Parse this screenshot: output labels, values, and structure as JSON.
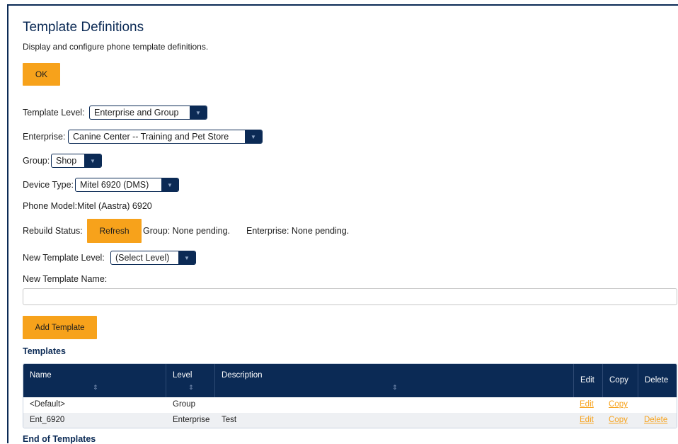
{
  "page": {
    "title": "Template Definitions",
    "subtitle": "Display and configure phone template definitions.",
    "ok_label": "OK"
  },
  "form": {
    "template_level_label": "Template Level:",
    "template_level_value": "Enterprise and Group",
    "enterprise_label": "Enterprise:",
    "enterprise_value": "Canine Center -- Training and Pet Store",
    "group_label": "Group:",
    "group_value": "Shop",
    "device_type_label": "Device Type:",
    "device_type_value": "Mitel 6920 (DMS)",
    "phone_model_text": "Phone Model:Mitel (Aastra) 6920",
    "rebuild_status_label": "Rebuild Status:",
    "refresh_label": "Refresh",
    "group_status": "Group: None pending.",
    "enterprise_status": "Enterprise: None pending.",
    "new_template_level_label": "New Template Level:",
    "new_template_level_value": "(Select Level)",
    "new_template_name_label": "New Template Name:",
    "new_template_name_value": "",
    "add_template_label": "Add Template"
  },
  "templates": {
    "heading": "Templates",
    "columns": {
      "name": "Name",
      "level": "Level",
      "description": "Description",
      "edit": "Edit",
      "copy": "Copy",
      "delete": "Delete"
    },
    "rows": [
      {
        "name": "<Default>",
        "level": "Group",
        "description": "",
        "edit": "Edit",
        "copy": "Copy",
        "delete": ""
      },
      {
        "name": "Ent_6920",
        "level": "Enterprise",
        "description": "Test",
        "edit": "Edit",
        "copy": "Copy",
        "delete": "Delete"
      }
    ],
    "footer": "End of Templates"
  },
  "colors": {
    "accent": "#f7a21b",
    "header_navy": "#0b2a55",
    "row_alt": "#eef0f3"
  },
  "icons": {
    "dropdown": "chevron-down-icon",
    "sort": "sort-icon"
  }
}
